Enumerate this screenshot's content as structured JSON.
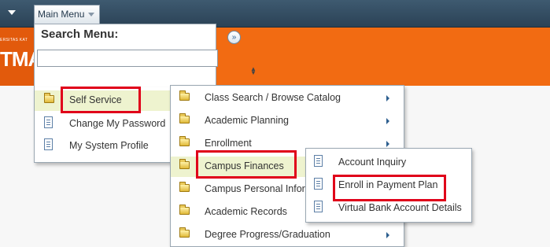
{
  "header": {
    "main_menu_label": "Main Menu"
  },
  "banner": {
    "logo_small_text": "ERSITAS KAT",
    "logo_text": "TMA"
  },
  "search": {
    "title": "Search Menu:",
    "value": "",
    "go_glyph": "»"
  },
  "menu_level_1": {
    "items": [
      {
        "label": "Self Service",
        "icon": "folder-icon",
        "highlighted": true
      },
      {
        "label": "Change My Password",
        "icon": "document-icon"
      },
      {
        "label": "My System Profile",
        "icon": "document-icon"
      }
    ]
  },
  "menu_level_2": {
    "items": [
      {
        "label": "Class Search / Browse Catalog",
        "icon": "folder-icon",
        "has_submenu": true
      },
      {
        "label": "Academic Planning",
        "icon": "folder-icon",
        "has_submenu": true
      },
      {
        "label": "Enrollment",
        "icon": "folder-icon",
        "has_submenu": true
      },
      {
        "label": "Campus Finances",
        "icon": "folder-icon",
        "highlighted": true,
        "has_submenu": true
      },
      {
        "label": "Campus Personal Infori",
        "icon": "folder-icon"
      },
      {
        "label": "Academic Records",
        "icon": "folder-icon"
      },
      {
        "label": "Degree Progress/Graduation",
        "icon": "folder-icon",
        "has_submenu": true
      }
    ]
  },
  "menu_level_3": {
    "items": [
      {
        "label": "Account Inquiry",
        "icon": "document-icon"
      },
      {
        "label": "Enroll in Payment Plan",
        "icon": "document-icon"
      },
      {
        "label": "Virtual Bank Account Details",
        "icon": "document-icon"
      }
    ]
  },
  "colors": {
    "topbar": "#2b4256",
    "banner": "#f26b12",
    "highlight": "#eef3cf",
    "annotation_red": "#e0001a"
  }
}
